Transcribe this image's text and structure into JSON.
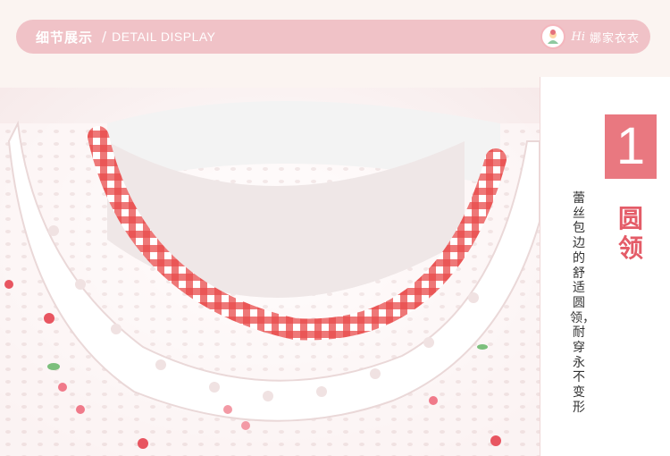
{
  "header": {
    "title_cn": "细节展示",
    "separator": "/",
    "title_en": "DETAIL DISPLAY",
    "brand_hi": "Hi",
    "brand_name": "娜家衣衣",
    "bar_color": "#f0c2c7"
  },
  "detail": {
    "number": "1",
    "feature_title": "圆领",
    "description": "蕾丝包边的舒适圆领，耐穿永不变形",
    "accent_color": "#e97880"
  },
  "photo": {
    "subject": "baby garment round neck with red gingham piping and white eyelet lace collar"
  }
}
